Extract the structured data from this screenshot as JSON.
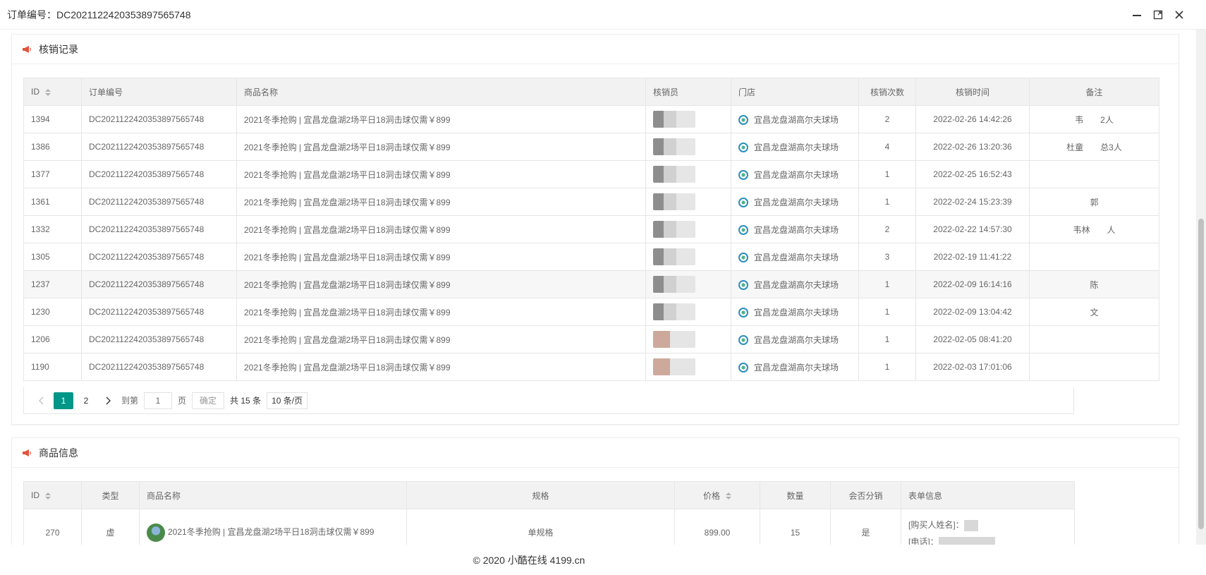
{
  "window": {
    "title": "订单编号：DC20211224203538975657​48"
  },
  "records": {
    "heading": "核销记录",
    "columns": [
      "ID",
      "订单编号",
      "商品名称",
      "核销员",
      "门店",
      "核销次数",
      "核销时间",
      "备注"
    ],
    "rows": [
      {
        "id": "1394",
        "order": "DC20211224203538975657​48",
        "product": "2021冬季抢购 | 宜昌龙盘湖2场平日18洞击球仅需￥899",
        "store": "宜昌龙盘湖高尔夫球场",
        "count": "2",
        "time": "2022-02-26 14:42:26",
        "note": "韦　　2人"
      },
      {
        "id": "1386",
        "order": "DC20211224203538975657​48",
        "product": "2021冬季抢购 | 宜昌龙盘湖2场平日18洞击球仅需￥899",
        "store": "宜昌龙盘湖高尔夫球场",
        "count": "4",
        "time": "2022-02-26 13:20:36",
        "note": "杜童　　总3人"
      },
      {
        "id": "1377",
        "order": "DC20211224203538975657​48",
        "product": "2021冬季抢购 | 宜昌龙盘湖2场平日18洞击球仅需￥899",
        "store": "宜昌龙盘湖高尔夫球场",
        "count": "1",
        "time": "2022-02-25 16:52:43",
        "note": ""
      },
      {
        "id": "1361",
        "order": "DC20211224203538975657​48",
        "product": "2021冬季抢购 | 宜昌龙盘湖2场平日18洞击球仅需￥899",
        "store": "宜昌龙盘湖高尔夫球场",
        "count": "1",
        "time": "2022-02-24 15:23:39",
        "note": "郭"
      },
      {
        "id": "1332",
        "order": "DC20211224203538975657​48",
        "product": "2021冬季抢购 | 宜昌龙盘湖2场平日18洞击球仅需￥899",
        "store": "宜昌龙盘湖高尔夫球场",
        "count": "2",
        "time": "2022-02-22 14:57:30",
        "note": "韦林　　人"
      },
      {
        "id": "1305",
        "order": "DC20211224203538975657​48",
        "product": "2021冬季抢购 | 宜昌龙盘湖2场平日18洞击球仅需￥899",
        "store": "宜昌龙盘湖高尔夫球场",
        "count": "3",
        "time": "2022-02-19 11:41:22",
        "note": ""
      },
      {
        "id": "1237",
        "order": "DC20211224203538975657​48",
        "product": "2021冬季抢购 | 宜昌龙盘湖2场平日18洞击球仅需￥899",
        "store": "宜昌龙盘湖高尔夫球场",
        "count": "1",
        "time": "2022-02-09 16:14:16",
        "note": "陈"
      },
      {
        "id": "1230",
        "order": "DC20211224203538975657​48",
        "product": "2021冬季抢购 | 宜昌龙盘湖2场平日18洞击球仅需￥899",
        "store": "宜昌龙盘湖高尔夫球场",
        "count": "1",
        "time": "2022-02-09 13:04:42",
        "note": "文"
      },
      {
        "id": "1206",
        "order": "DC20211224203538975657​48",
        "product": "2021冬季抢购 | 宜昌龙盘湖2场平日18洞击球仅需￥899",
        "store": "宜昌龙盘湖高尔夫球场",
        "count": "1",
        "time": "2022-02-05 08:41:20",
        "note": ""
      },
      {
        "id": "1190",
        "order": "DC20211224203538975657​48",
        "product": "2021冬季抢购 | 宜昌龙盘湖2场平日18洞击球仅需￥899",
        "store": "宜昌龙盘湖高尔夫球场",
        "count": "1",
        "time": "2022-02-03 17:01:06",
        "note": ""
      }
    ],
    "pager": {
      "page1": "1",
      "page2": "2",
      "goto": "到第",
      "page_value": "1",
      "page_unit": "页",
      "confirm": "确定",
      "total": "共 15 条",
      "per_page": "10 条/页"
    }
  },
  "goods": {
    "heading": "商品信息",
    "columns": [
      "ID",
      "类型",
      "商品名称",
      "规格",
      "价格",
      "数量",
      "会否分销",
      "表单信息"
    ],
    "row": {
      "id": "270",
      "type": "虚",
      "product": "2021冬季抢购 | 宜昌龙盘湖2场平日18洞击球仅需￥899",
      "spec": "单规格",
      "price": "899.00",
      "qty": "15",
      "distribution": "是",
      "form_name_label": "[购买人姓名]：",
      "form_phone_label": "[电话]："
    }
  },
  "footer": {
    "copyright": "© 2020 小酷在线 4199.cn"
  }
}
